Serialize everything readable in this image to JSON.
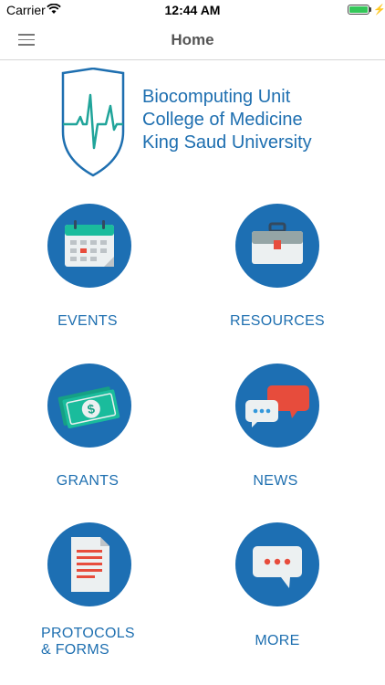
{
  "status_bar": {
    "carrier": "Carrier",
    "time": "12:44 AM"
  },
  "nav": {
    "title": "Home"
  },
  "header": {
    "org_line1": "Biocomputing Unit",
    "org_line2": "College of Medicine",
    "org_line3": "King Saud University"
  },
  "tiles": [
    {
      "label": "EVENTS",
      "icon": "calendar-icon"
    },
    {
      "label": "RESOURCES",
      "icon": "briefcase-icon"
    },
    {
      "label": "GRANTS",
      "icon": "money-icon"
    },
    {
      "label": "NEWS",
      "icon": "chat-bubbles-icon"
    },
    {
      "label_line1": "PROTOCOLS",
      "label_line2": "& FORMS",
      "icon": "document-icon"
    },
    {
      "label": "MORE",
      "icon": "more-chat-icon"
    }
  ],
  "colors": {
    "brand_blue": "#1d6fb3",
    "accent_red": "#e74c3c",
    "logo_teal": "#20a49a"
  }
}
